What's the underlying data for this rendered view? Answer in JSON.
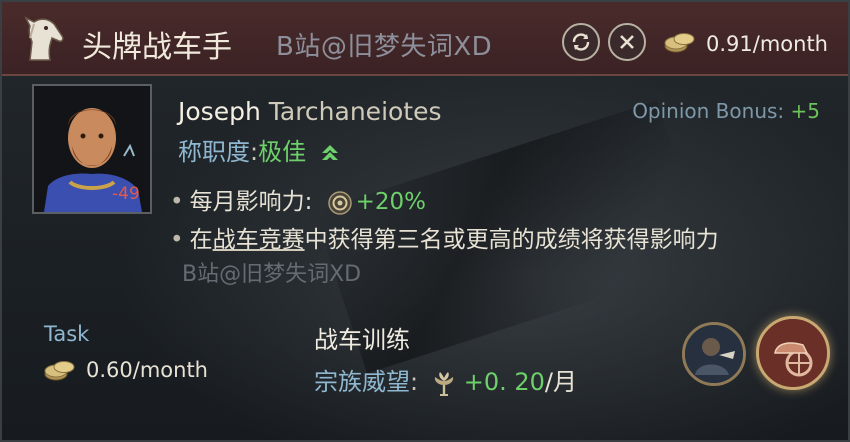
{
  "header": {
    "title": "头牌战车手",
    "watermark": "B站@旧梦失词XD",
    "cost": "0.91/month",
    "buttons": [
      "cycle-icon",
      "close-icon"
    ]
  },
  "character": {
    "first_name": "Joseph",
    "last_name": "Tarchaneiotes",
    "age_modifier": "-49",
    "opinion_label": "Opinion Bonus:",
    "opinion_value": "+5",
    "competence_label": "称职度",
    "competence_sep": ":",
    "competence_value": "极佳"
  },
  "effects": {
    "influence_label": "每月影响力:",
    "influence_value": "+20%",
    "line2_pre": "在",
    "line2_link": "战车竞赛",
    "line2_post": "中获得第三名或更高的成绩将获得影响力"
  },
  "watermark_mid": "B站@旧梦失词XD",
  "task": {
    "label": "Task",
    "cost": "0.60/month",
    "name": "战车训练",
    "prestige_label": "宗族威望",
    "prestige_sep": ":",
    "prestige_value": "+0. 20",
    "prestige_unit": "/月"
  },
  "colors": {
    "header_bg": "#4a2b2b",
    "positive": "#6ed06a",
    "label_blue": "#8fb8d0",
    "negative": "#e35a4a"
  }
}
